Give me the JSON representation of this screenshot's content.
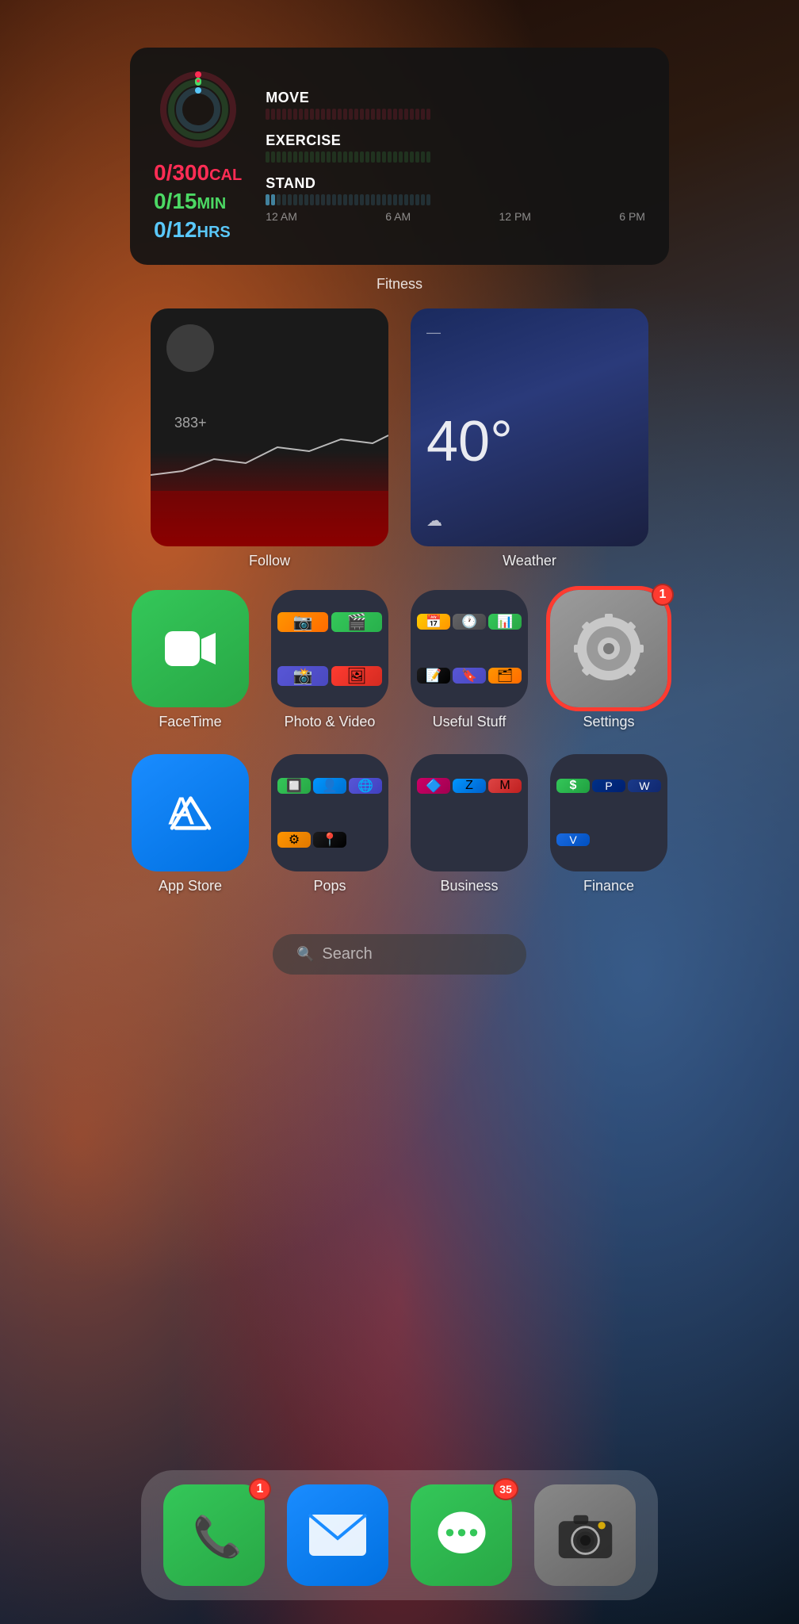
{
  "wallpaper": "ios-wallpaper",
  "fitness_widget": {
    "label": "Fitness",
    "move_value": "0/300",
    "move_unit": "CAL",
    "exercise_value": "0/15",
    "exercise_unit": "MIN",
    "stand_value": "0/12",
    "stand_unit": "HRS",
    "move_label": "MOVE",
    "exercise_label": "EXERCISE",
    "stand_label": "STAND",
    "time_labels": [
      "12 AM",
      "6 AM",
      "12 PM",
      "6 PM"
    ]
  },
  "widget_row": {
    "follow_label": "Follow",
    "weather_label": "Weather",
    "weather_temp": "40°"
  },
  "app_row_1": {
    "facetime_label": "FaceTime",
    "photo_video_label": "Photo & Video",
    "useful_stuff_label": "Useful Stuff",
    "settings_label": "Settings",
    "settings_badge": "1"
  },
  "app_row_2": {
    "appstore_label": "App Store",
    "pops_label": "Pops",
    "business_label": "Business",
    "finance_label": "Finance"
  },
  "search": {
    "placeholder": "Search",
    "icon": "search-icon"
  },
  "dock": {
    "phone_label": "Phone",
    "phone_badge": "1",
    "mail_label": "Mail",
    "messages_label": "Messages",
    "messages_badge": "35",
    "camera_label": "Camera"
  }
}
